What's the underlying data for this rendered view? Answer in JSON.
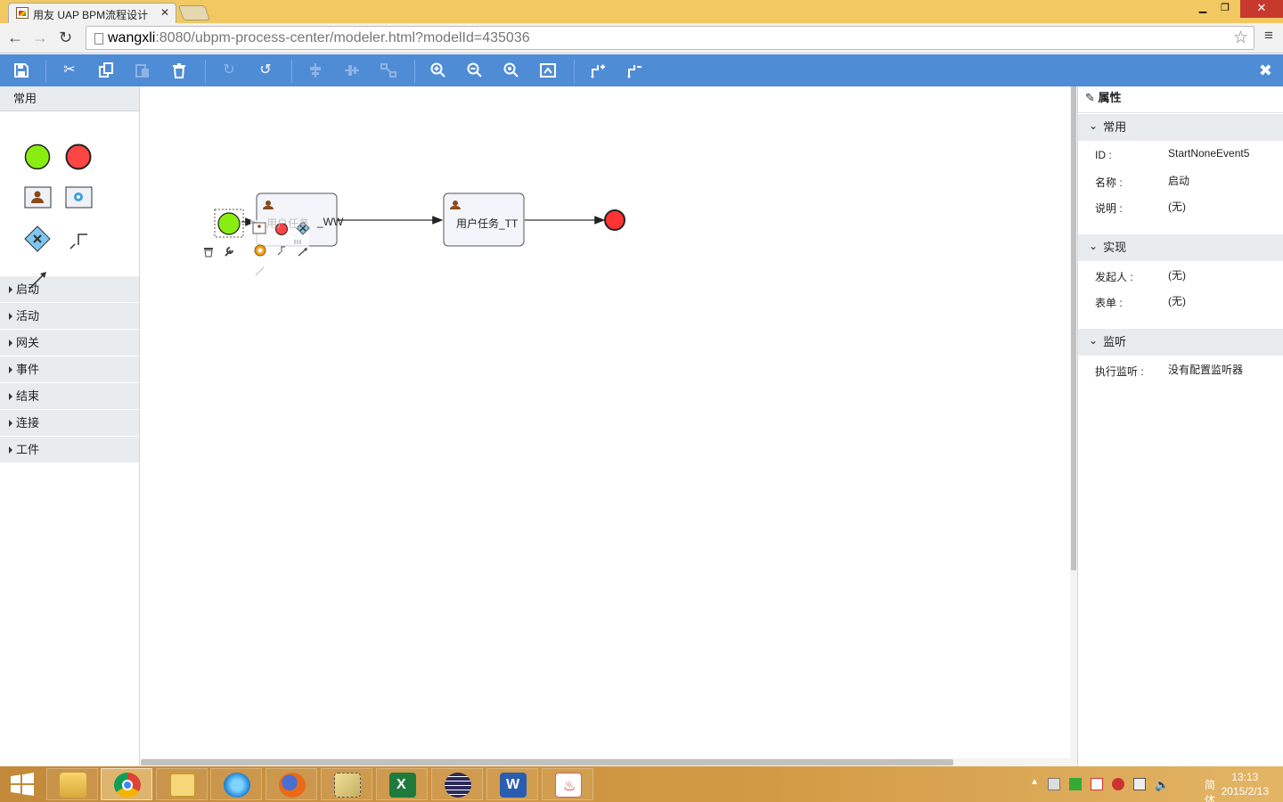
{
  "browser": {
    "tab_title": "用友 UAP BPM流程设计",
    "tab_close": "✕",
    "url_host": "wangxli",
    "url_rest": ":8080/ubpm-process-center/modeler.html?modelId=435036"
  },
  "toolbar": {
    "buttons": [
      "save",
      "cut",
      "copy",
      "paste",
      "delete",
      "redo",
      "undo",
      "align",
      "align-vertical",
      "size",
      "zoom-in",
      "zoom-out",
      "zoom-actual",
      "zoom-fit",
      "bend-add",
      "bend-remove"
    ],
    "close": "✖"
  },
  "sidebar": {
    "header": "常用",
    "groups": [
      "启动",
      "活动",
      "网关",
      "事件",
      "结束",
      "连接",
      "工件"
    ]
  },
  "diagram": {
    "task1_label": "用户任务_WW",
    "task1_visible": "_WW",
    "task1_ghost": "用户任务",
    "task2_label": "用户任务_TT"
  },
  "properties": {
    "title": "属性",
    "sections": [
      {
        "title": "常用",
        "rows": [
          {
            "label": "ID :",
            "value": "StartNoneEvent5"
          },
          {
            "label": "名称 :",
            "value": "启动"
          },
          {
            "label": "说明 :",
            "value": "(无)"
          }
        ]
      },
      {
        "title": "实现",
        "rows": [
          {
            "label": "发起人 :",
            "value": "(无)"
          },
          {
            "label": "表单 :",
            "value": "(无)"
          }
        ]
      },
      {
        "title": "监听",
        "rows": [
          {
            "label": "执行监听 :",
            "value": "没有配置监听器"
          }
        ]
      }
    ]
  },
  "taskbar": {
    "apps": [
      "file-explorer",
      "chrome",
      "outlook",
      "internet-explorer",
      "firefox",
      "snipping-tool",
      "excel",
      "eclipse",
      "word",
      "java"
    ],
    "active": "chrome",
    "ime": "简体",
    "time": "13:13",
    "date": "2015/2/13"
  },
  "colors": {
    "toolbar": "#4f8cd6",
    "start_event": "#88ee11",
    "end_event": "#ff4444",
    "titlebar": "#f2c860"
  }
}
